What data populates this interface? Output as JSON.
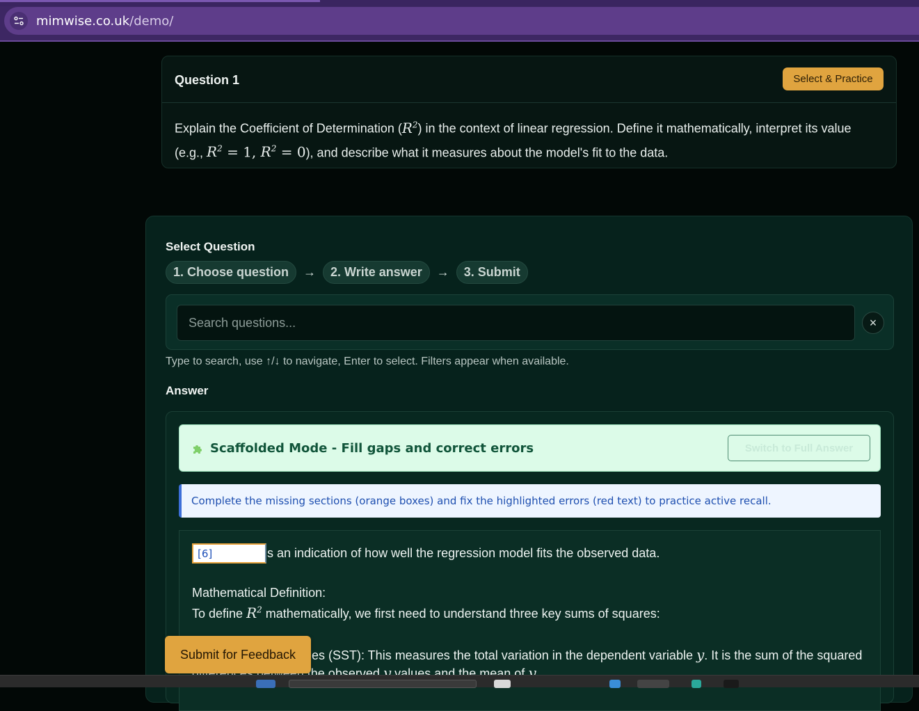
{
  "browser": {
    "url_host": "mimwise.co.uk",
    "url_path": "/demo/"
  },
  "question": {
    "title": "Question 1",
    "select_button": "Select & Practice",
    "text_part1": "Explain the Coefficient of Determination (",
    "text_part2": ") in the context of linear regression. Define it mathematically, interpret its value",
    "text_part3": "(e.g., ",
    "text_part4": "), and describe what it measures about the model's fit to the data."
  },
  "panel": {
    "select_title": "Select Question",
    "steps": [
      "1. Choose question",
      "2. Write answer",
      "3. Submit"
    ],
    "arrow": "→",
    "search_placeholder": "Search questions...",
    "clear_icon": "×",
    "hint": "Type to search, use ↑/↓ to navigate, Enter to select. Filters appear when available.",
    "answer_title": "Answer"
  },
  "answer": {
    "mode_label": "Scaffolded Mode - Fill gaps and correct errors",
    "switch_button": "Switch to Full Answer",
    "info": "Complete the missing sections (orange boxes) and fix the highlighted errors (red text) to practice active recall.",
    "gap_value": "[6]",
    "line1": "s an indication of how well the regression model fits the observed data.",
    "line2": "Mathematical Definition:",
    "line3_a": "To define ",
    "line3_b": " mathematically, we first need to understand three key sums of squares:",
    "line4_a": "es (SST): This measures the total variation in the dependent variable ",
    "line4_b": ". It is the sum of the squared",
    "line5_a": "differences between the observed ",
    "line5_b": " values and the mean of "
  },
  "submit_button": "Submit for Feedback",
  "colors": {
    "accent": "#e0a43f",
    "browser": "#5e3d8a",
    "mode_bg": "#dcfbe8",
    "info_border": "#3d6fd8"
  },
  "icons": [
    "site-settings-icon",
    "close-icon",
    "puzzle-icon"
  ]
}
